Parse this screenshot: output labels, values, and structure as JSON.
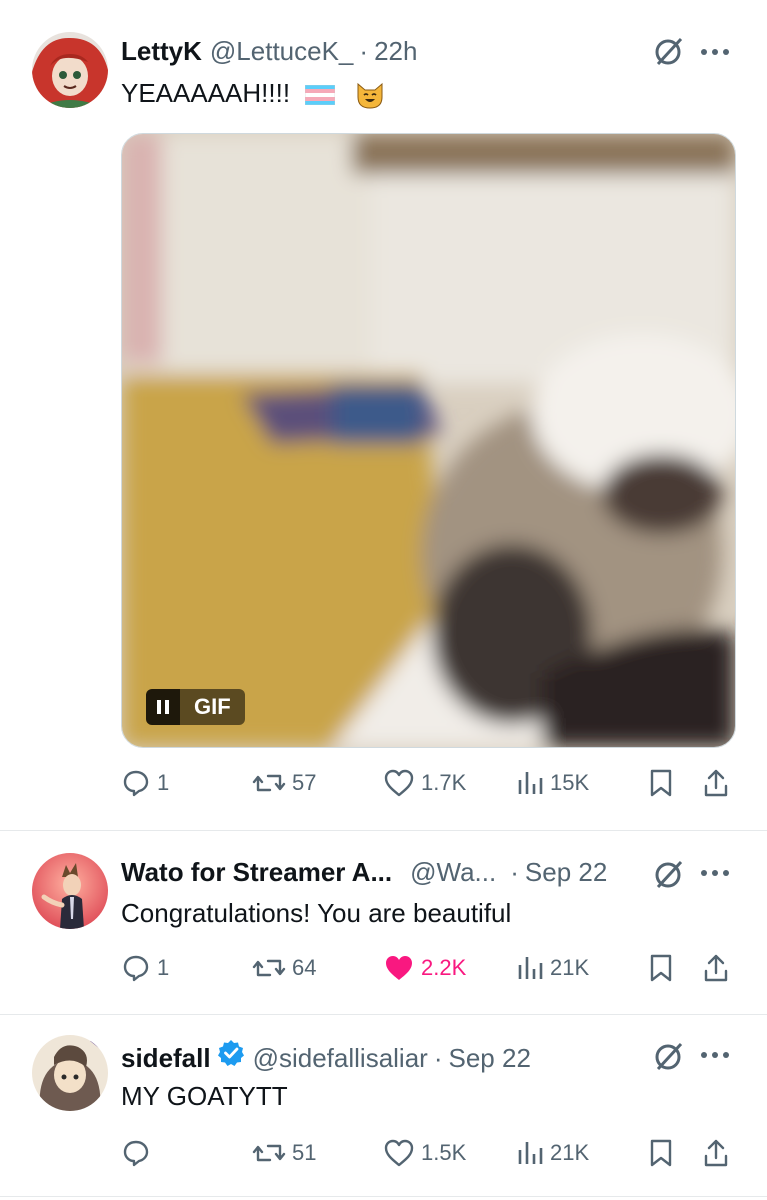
{
  "tweets": [
    {
      "name": "LettyK",
      "handle": "@LettuceK_",
      "dot": "·",
      "time": "22h",
      "text": "YEAAAAAH!!!!",
      "emoji": [
        "transgender-flag",
        "smiling-cat-face"
      ],
      "media": {
        "type": "GIF",
        "badge": "GIF"
      },
      "stats": {
        "replies": "1",
        "reposts": "57",
        "likes": "1.7K",
        "views": "15K"
      },
      "liked": false
    },
    {
      "name": "Wato for Streamer A...",
      "handle": "@Wa...",
      "dot": "·",
      "time": "Sep 22",
      "text": "Congratulations! You are beautiful",
      "stats": {
        "replies": "1",
        "reposts": "64",
        "likes": "2.2K",
        "views": "21K"
      },
      "liked": true
    },
    {
      "name": "sidefall",
      "verified": true,
      "handle": "@sidefallisaliar",
      "dot": "·",
      "time": "Sep 22",
      "text": "MY GOATYTT",
      "stats": {
        "replies": "",
        "reposts": "51",
        "likes": "1.5K",
        "views": "21K"
      },
      "liked": false
    }
  ],
  "colors": {
    "like_active": "#f91880",
    "secondary": "#536471",
    "verified": "#1d9bf0"
  }
}
